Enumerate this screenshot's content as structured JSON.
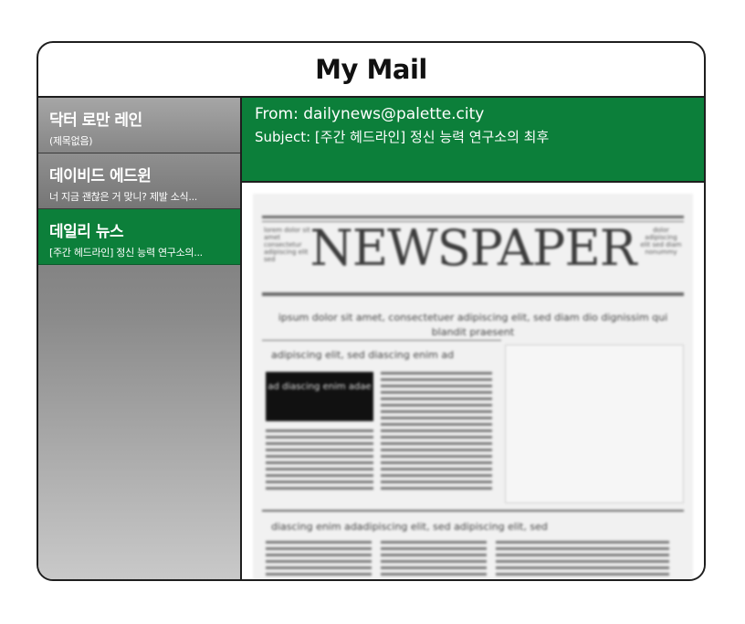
{
  "window": {
    "title": "My Mail"
  },
  "mail_list": [
    {
      "sender": "닥터 로만 레인",
      "preview": "(제목없음)",
      "selected": false
    },
    {
      "sender": "데이비드 에드윈",
      "preview": "너 지금 괜찮은 거 맞니? 제발 소식...",
      "selected": false
    },
    {
      "sender": "데일리 뉴스",
      "preview": "[주간 헤드라인] 정신 능력 연구소의...",
      "selected": true
    }
  ],
  "message": {
    "from_label": "From:",
    "from": "dailynews@palette.city",
    "subject_label": "Subject:",
    "subject": "[주간 헤드라인] 정신 능력 연구소의 최후"
  },
  "newspaper": {
    "masthead": "NEWSPAPER",
    "ear_left": "lorem dolor sit amet consectetur adipiscing elit sed",
    "ear_right": "dolor adipiscing elit sed diam nonummy",
    "tagline": "ipsum dolor sit amet, consectetuer adipiscing elit, sed diam dio dignissim qui blandit praesent",
    "section_head_1": "adipiscing elit, sed diascing enim ad",
    "box_caption": "ad diascing enim adae",
    "section_head_2": "diascing enim adadipiscing elit, sed adipiscing elit, sed"
  },
  "colors": {
    "accent_green": "#0c7f3a",
    "sidebar_gray": "#7a7a7a",
    "border": "#1e1e1e"
  }
}
